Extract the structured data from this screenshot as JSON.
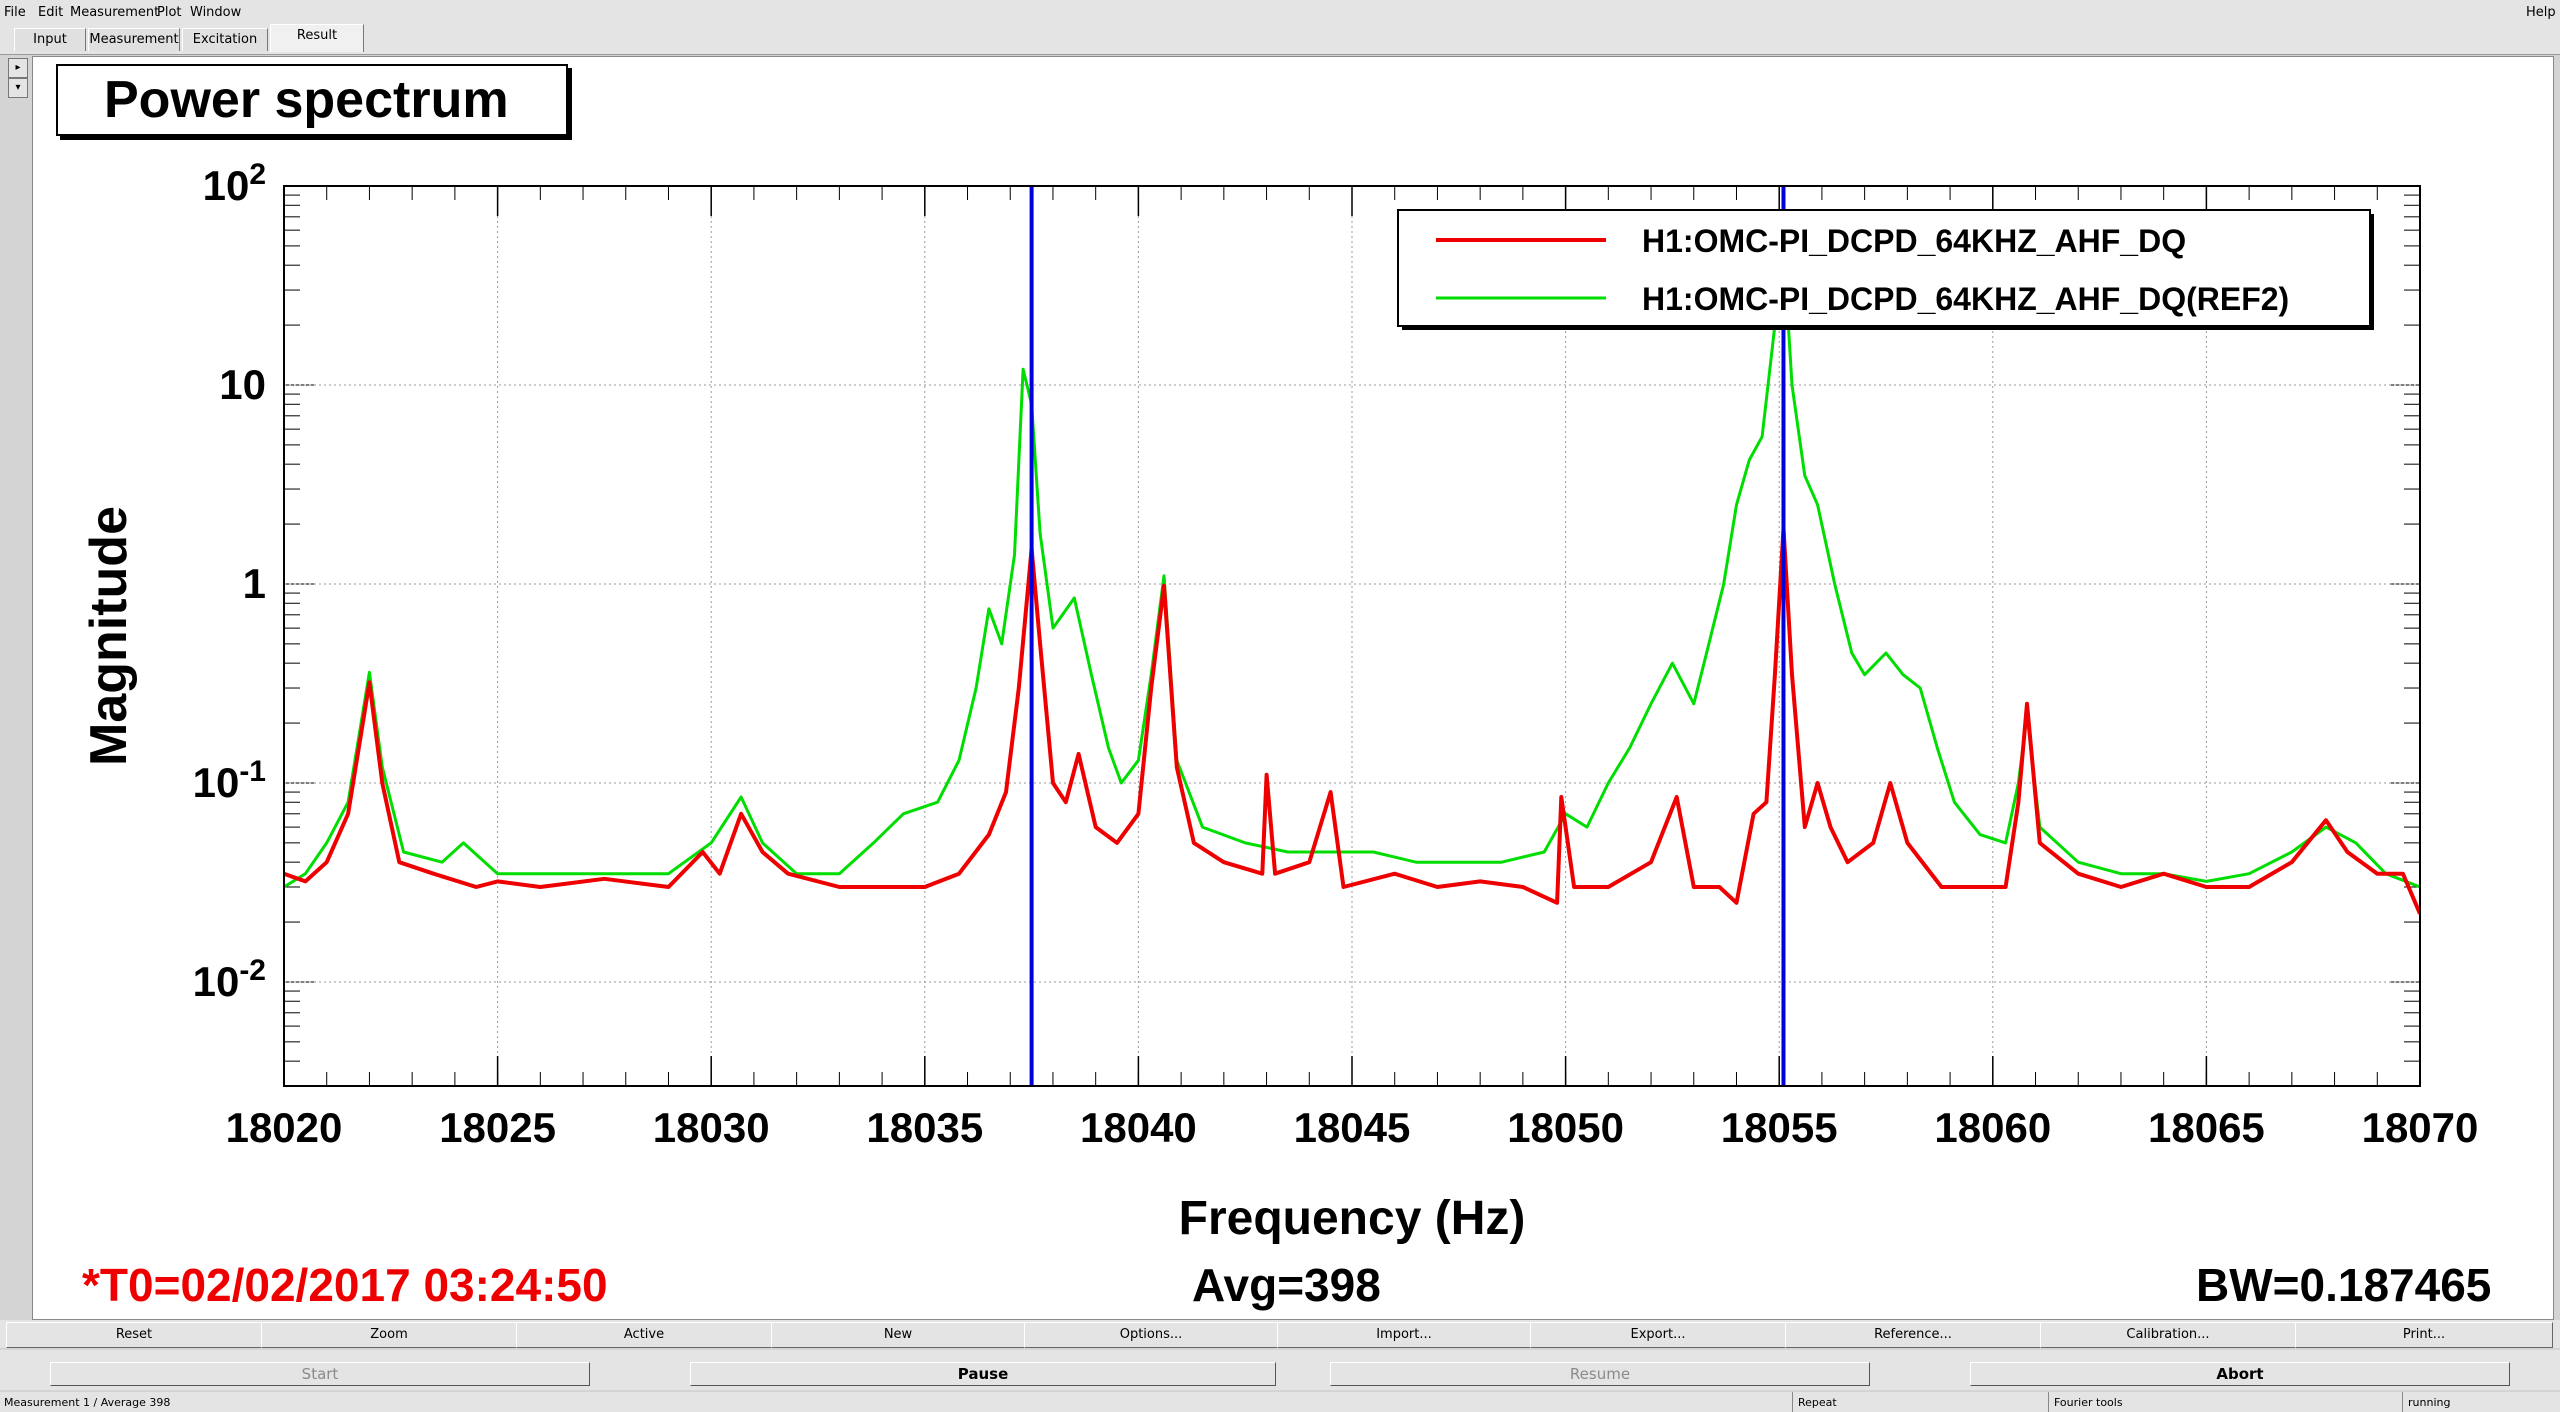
{
  "menu": {
    "file": "File",
    "edit": "Edit",
    "measurement": "Measurement",
    "plot": "Plot",
    "window": "Window",
    "help": "Help"
  },
  "tabs": [
    "Input",
    "Measurement",
    "Excitation",
    "Result"
  ],
  "active_tab": "Result",
  "plot": {
    "title": "Power spectrum",
    "t0": "*T0=02/02/2017 03:24:50",
    "avg": "Avg=398",
    "bw": "BW=0.187465"
  },
  "colors": {
    "series1": "#ee0000",
    "series2": "#00dd00",
    "cursor": "#0000dd",
    "t0_text": "#ee0000"
  },
  "chart_data": {
    "type": "line",
    "title": "Power spectrum",
    "xlabel": "Frequency (Hz)",
    "ylabel": "Magnitude",
    "xlim": [
      18020,
      18070
    ],
    "ylim": [
      0.003,
      100
    ],
    "yscale": "log",
    "grid": true,
    "legend_position": "top-right",
    "x_ticks": [
      "18020",
      "18025",
      "18030",
      "18035",
      "18040",
      "18045",
      "18050",
      "18055",
      "18060",
      "18065",
      "18070"
    ],
    "y_ticks": [
      {
        "base": "10",
        "exp": "-2",
        "value": 0.01
      },
      {
        "base": "10",
        "exp": "-1",
        "value": 0.1
      },
      {
        "base": "1",
        "exp": "",
        "value": 1
      },
      {
        "base": "10",
        "exp": "",
        "value": 10
      },
      {
        "base": "10",
        "exp": "2",
        "value": 100
      }
    ],
    "cursors": [
      18037.5,
      18055.1
    ],
    "series": [
      {
        "name": "H1:OMC-PI_DCPD_64KHZ_AHF_DQ",
        "color": "#ee0000",
        "points": [
          [
            18020.0,
            0.035
          ],
          [
            18020.5,
            0.032
          ],
          [
            18021.0,
            0.04
          ],
          [
            18021.5,
            0.07
          ],
          [
            18022.0,
            0.32
          ],
          [
            18022.3,
            0.1
          ],
          [
            18022.7,
            0.04
          ],
          [
            18023.5,
            0.035
          ],
          [
            18024.5,
            0.03
          ],
          [
            18025.0,
            0.032
          ],
          [
            18026.0,
            0.03
          ],
          [
            18027.5,
            0.033
          ],
          [
            18029.0,
            0.03
          ],
          [
            18029.8,
            0.045
          ],
          [
            18030.2,
            0.035
          ],
          [
            18030.7,
            0.07
          ],
          [
            18031.2,
            0.045
          ],
          [
            18031.8,
            0.035
          ],
          [
            18033.0,
            0.03
          ],
          [
            18034.0,
            0.03
          ],
          [
            18035.0,
            0.03
          ],
          [
            18035.8,
            0.035
          ],
          [
            18036.5,
            0.055
          ],
          [
            18036.9,
            0.09
          ],
          [
            18037.2,
            0.3
          ],
          [
            18037.5,
            1.5
          ],
          [
            18037.7,
            0.5
          ],
          [
            18038.0,
            0.1
          ],
          [
            18038.3,
            0.08
          ],
          [
            18038.6,
            0.14
          ],
          [
            18039.0,
            0.06
          ],
          [
            18039.5,
            0.05
          ],
          [
            18040.0,
            0.07
          ],
          [
            18040.3,
            0.3
          ],
          [
            18040.6,
            0.98
          ],
          [
            18040.9,
            0.12
          ],
          [
            18041.3,
            0.05
          ],
          [
            18042.0,
            0.04
          ],
          [
            18042.9,
            0.035
          ],
          [
            18043.0,
            0.11
          ],
          [
            18043.2,
            0.035
          ],
          [
            18044.0,
            0.04
          ],
          [
            18044.5,
            0.09
          ],
          [
            18044.8,
            0.03
          ],
          [
            18046.0,
            0.035
          ],
          [
            18047.0,
            0.03
          ],
          [
            18048.0,
            0.032
          ],
          [
            18049.0,
            0.03
          ],
          [
            18049.8,
            0.025
          ],
          [
            18049.9,
            0.085
          ],
          [
            18050.2,
            0.03
          ],
          [
            18051.0,
            0.03
          ],
          [
            18052.0,
            0.04
          ],
          [
            18052.6,
            0.085
          ],
          [
            18053.0,
            0.03
          ],
          [
            18053.6,
            0.03
          ],
          [
            18054.0,
            0.025
          ],
          [
            18054.4,
            0.07
          ],
          [
            18054.7,
            0.08
          ],
          [
            18054.9,
            0.35
          ],
          [
            18055.1,
            1.9
          ],
          [
            18055.3,
            0.35
          ],
          [
            18055.6,
            0.06
          ],
          [
            18055.9,
            0.1
          ],
          [
            18056.2,
            0.06
          ],
          [
            18056.6,
            0.04
          ],
          [
            18057.2,
            0.05
          ],
          [
            18057.6,
            0.1
          ],
          [
            18058.0,
            0.05
          ],
          [
            18058.8,
            0.03
          ],
          [
            18059.5,
            0.03
          ],
          [
            18060.3,
            0.03
          ],
          [
            18060.6,
            0.08
          ],
          [
            18060.8,
            0.25
          ],
          [
            18061.1,
            0.05
          ],
          [
            18062.0,
            0.035
          ],
          [
            18063.0,
            0.03
          ],
          [
            18064.0,
            0.035
          ],
          [
            18065.0,
            0.03
          ],
          [
            18066.0,
            0.03
          ],
          [
            18067.0,
            0.04
          ],
          [
            18067.8,
            0.065
          ],
          [
            18068.3,
            0.045
          ],
          [
            18069.0,
            0.035
          ],
          [
            18069.6,
            0.035
          ],
          [
            18070.0,
            0.022
          ]
        ]
      },
      {
        "name": "H1:OMC-PI_DCPD_64KHZ_AHF_DQ(REF2)",
        "color": "#00dd00",
        "points": [
          [
            18020.0,
            0.03
          ],
          [
            18020.5,
            0.035
          ],
          [
            18021.0,
            0.05
          ],
          [
            18021.5,
            0.08
          ],
          [
            18022.0,
            0.36
          ],
          [
            18022.3,
            0.12
          ],
          [
            18022.8,
            0.045
          ],
          [
            18023.7,
            0.04
          ],
          [
            18024.2,
            0.05
          ],
          [
            18025.0,
            0.035
          ],
          [
            18026.0,
            0.035
          ],
          [
            18027.5,
            0.035
          ],
          [
            18029.0,
            0.035
          ],
          [
            18030.0,
            0.05
          ],
          [
            18030.7,
            0.085
          ],
          [
            18031.2,
            0.05
          ],
          [
            18032.0,
            0.035
          ],
          [
            18033.0,
            0.035
          ],
          [
            18033.8,
            0.05
          ],
          [
            18034.5,
            0.07
          ],
          [
            18035.3,
            0.08
          ],
          [
            18035.8,
            0.13
          ],
          [
            18036.2,
            0.3
          ],
          [
            18036.5,
            0.75
          ],
          [
            18036.8,
            0.5
          ],
          [
            18037.1,
            1.4
          ],
          [
            18037.3,
            12
          ],
          [
            18037.5,
            8
          ],
          [
            18037.7,
            1.8
          ],
          [
            18038.0,
            0.6
          ],
          [
            18038.5,
            0.85
          ],
          [
            18038.9,
            0.35
          ],
          [
            18039.3,
            0.15
          ],
          [
            18039.6,
            0.1
          ],
          [
            18040.0,
            0.13
          ],
          [
            18040.3,
            0.35
          ],
          [
            18040.6,
            1.1
          ],
          [
            18040.9,
            0.13
          ],
          [
            18041.5,
            0.06
          ],
          [
            18042.5,
            0.05
          ],
          [
            18043.5,
            0.045
          ],
          [
            18044.5,
            0.045
          ],
          [
            18045.5,
            0.045
          ],
          [
            18046.5,
            0.04
          ],
          [
            18047.5,
            0.04
          ],
          [
            18048.5,
            0.04
          ],
          [
            18049.5,
            0.045
          ],
          [
            18050.0,
            0.07
          ],
          [
            18050.5,
            0.06
          ],
          [
            18051.0,
            0.1
          ],
          [
            18051.5,
            0.15
          ],
          [
            18052.0,
            0.25
          ],
          [
            18052.5,
            0.4
          ],
          [
            18053.0,
            0.25
          ],
          [
            18053.3,
            0.45
          ],
          [
            18053.7,
            1.0
          ],
          [
            18054.0,
            2.5
          ],
          [
            18054.3,
            4.2
          ],
          [
            18054.6,
            5.5
          ],
          [
            18054.9,
            20
          ],
          [
            18055.1,
            50
          ],
          [
            18055.3,
            10
          ],
          [
            18055.6,
            3.5
          ],
          [
            18055.9,
            2.5
          ],
          [
            18056.3,
            1.0
          ],
          [
            18056.7,
            0.45
          ],
          [
            18057.0,
            0.35
          ],
          [
            18057.5,
            0.45
          ],
          [
            18057.9,
            0.35
          ],
          [
            18058.3,
            0.3
          ],
          [
            18058.7,
            0.15
          ],
          [
            18059.1,
            0.08
          ],
          [
            18059.7,
            0.055
          ],
          [
            18060.3,
            0.05
          ],
          [
            18060.6,
            0.1
          ],
          [
            18060.8,
            0.22
          ],
          [
            18061.1,
            0.06
          ],
          [
            18062.0,
            0.04
          ],
          [
            18063.0,
            0.035
          ],
          [
            18064.0,
            0.035
          ],
          [
            18065.0,
            0.032
          ],
          [
            18066.0,
            0.035
          ],
          [
            18067.0,
            0.045
          ],
          [
            18067.8,
            0.06
          ],
          [
            18068.5,
            0.05
          ],
          [
            18069.2,
            0.035
          ],
          [
            18070.0,
            0.03
          ]
        ]
      }
    ]
  },
  "buttons": [
    "Reset",
    "Zoom",
    "Active",
    "New",
    "Options...",
    "Import...",
    "Export...",
    "Reference...",
    "Calibration...",
    "Print..."
  ],
  "controls": {
    "start": "Start",
    "pause": "Pause",
    "resume": "Resume",
    "abort": "Abort"
  },
  "status": {
    "measurement": "Measurement 1 / Average 398",
    "repeat": "Repeat",
    "tools": "Fourier tools",
    "state": "running"
  }
}
